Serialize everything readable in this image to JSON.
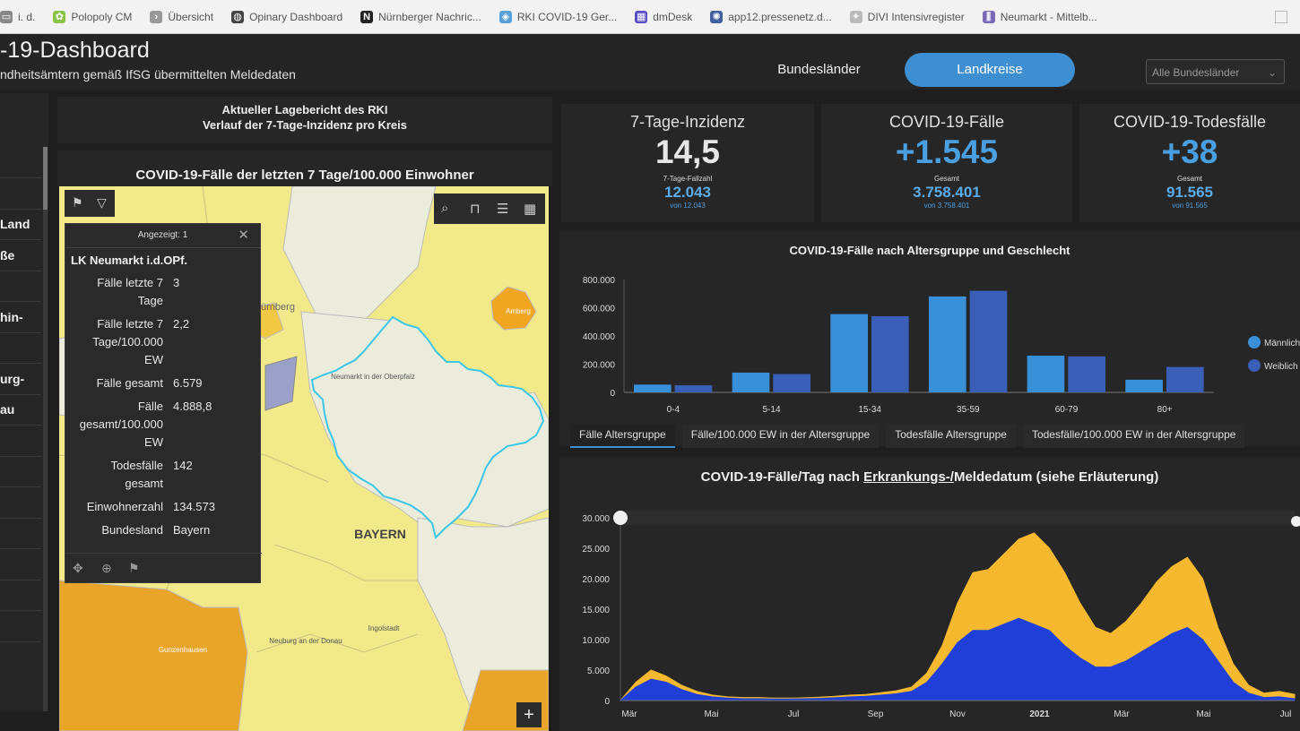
{
  "bookmarks": [
    {
      "label": "i. d.",
      "icon": "tab-icon"
    },
    {
      "label": "Polopoly CM",
      "icon": "leaf-icon"
    },
    {
      "label": "Übersicht",
      "icon": "chevron-icon"
    },
    {
      "label": "Opinary Dashboard",
      "icon": "globe-icon"
    },
    {
      "label": "Nürnberger Nachric...",
      "icon": "nn-icon"
    },
    {
      "label": "RKI COVID-19 Ger...",
      "icon": "shield-icon"
    },
    {
      "label": "dmDesk",
      "icon": "grid-icon"
    },
    {
      "label": "app12.pressenetz.d...",
      "icon": "gear-icon"
    },
    {
      "label": "DIVI Intensivregister",
      "icon": "star-icon"
    },
    {
      "label": "Neumarkt - Mittelb...",
      "icon": "columns-icon"
    }
  ],
  "header": {
    "title": "-19-Dashboard",
    "subtitle": "ndheitsämtern gemäß IfSG übermittelten Meldedaten",
    "tab_bundeslaender": "Bundesländer",
    "tab_landkreise": "Landkreise",
    "select_value": "Alle Bundesländer"
  },
  "sidebar": {
    "items": [
      "",
      "",
      "Land",
      "ße",
      "",
      "hin-",
      "",
      "urg-",
      "au",
      "",
      "",
      "",
      "",
      "",
      "",
      ""
    ]
  },
  "rki": {
    "line1": "Aktueller Lagebericht des RKI",
    "line2": "Verlauf der 7-Tage-Inzidenz pro Kreis"
  },
  "map": {
    "title": "COVID-19-Fälle der letzten 7 Tage/100.000 Einwohner",
    "labels": {
      "bayern": "BAYERN",
      "nurnberg": "ürnberg",
      "amberg": "Amberg",
      "neumarkt": "Neumarkt in der Oberpfalz",
      "neuburg": "Neuburg an der Donau",
      "ingolstadt": "Ingolstadt",
      "gunzenhausen": "Gunzenhausen"
    },
    "colors": {
      "light": "#f2e98a",
      "medium": "#f0c843",
      "dark": "#e8a52a",
      "pale": "#ececdc",
      "outline": "#3cc6e8"
    }
  },
  "popup": {
    "header": "Angezeigt: 1",
    "name": "LK Neumarkt i.d.OPf.",
    "rows": [
      {
        "key_lines": [
          "Fälle letzte 7",
          "Tage"
        ],
        "value": "3"
      },
      {
        "key_lines": [
          "Fälle letzte 7",
          "Tage/100.000",
          "EW"
        ],
        "value": "2,2"
      },
      {
        "key_lines": [
          "Fälle gesamt"
        ],
        "value": "6.579"
      },
      {
        "key_lines": [
          "Fälle",
          "gesamt/100.000",
          "EW"
        ],
        "value": "4.888,8"
      },
      {
        "key_lines": [
          "Todesfälle",
          "gesamt"
        ],
        "value": "142"
      },
      {
        "key_lines": [
          "Einwohnerzahl"
        ],
        "value": "134.573"
      },
      {
        "key_lines": [
          "Bundesland"
        ],
        "value": "Bayern"
      }
    ]
  },
  "kpis": [
    {
      "title": "7-Tage-Inzidenz",
      "value": "14,5",
      "value_color": "#e6e6e6",
      "sub_label": "7-Tage-Fallzahl",
      "sub_value": "12.043",
      "footer": "von 12.043"
    },
    {
      "title": "COVID-19-Fälle",
      "value": "+1.545",
      "value_color": "#4a9fe0",
      "sub_label": "Gesamt",
      "sub_value": "3.758.401",
      "footer": "von 3.758.401"
    },
    {
      "title": "COVID-19-Todesfälle",
      "value": "+38",
      "value_color": "#4a9fe0",
      "sub_label": "Gesamt",
      "sub_value": "91.565",
      "footer": "von 91.565"
    }
  ],
  "age_chart": {
    "title": "COVID-19-Fälle nach Altersgruppe und Geschlecht",
    "tabs": [
      "Fälle Altersgruppe",
      "Fälle/100.000 EW in der Altersgruppe",
      "Todesfälle Altersgruppe",
      "Todesfälle/100.000 EW in der Altersgruppe"
    ],
    "legend": [
      "Männlich",
      "Weiblich"
    ]
  },
  "daily_chart": {
    "title_pre": "COVID-19-Fälle/Tag nach ",
    "title_link": "Erkrankungs-/",
    "title_post": "Meldedatum (siehe Erläuterung)"
  },
  "chart_data": [
    {
      "type": "bar",
      "title": "COVID-19-Fälle nach Altersgruppe und Geschlecht",
      "categories": [
        "0-4",
        "5-14",
        "15-34",
        "35-59",
        "60-79",
        "80+"
      ],
      "series": [
        {
          "name": "Männlich",
          "color": "#3a8fd9",
          "values": [
            55000,
            140000,
            555000,
            680000,
            260000,
            90000
          ]
        },
        {
          "name": "Weiblich",
          "color": "#3a5fb8",
          "values": [
            50000,
            130000,
            540000,
            720000,
            255000,
            180000
          ]
        }
      ],
      "yticks": [
        "0",
        "200.000",
        "400.000",
        "600.000",
        "800.000"
      ],
      "ylim": [
        0,
        800000
      ],
      "legend_position": "right"
    },
    {
      "type": "area",
      "title": "COVID-19-Fälle/Tag nach Erkrankungs-/Meldedatum (siehe Erläuterung)",
      "x_ticks": [
        "Mär",
        "Mai",
        "Jul",
        "Sep",
        "Nov",
        "2021",
        "Mär",
        "Mai",
        "Jul"
      ],
      "yticks": [
        "0",
        "5.000",
        "10.000",
        "15.000",
        "20.000",
        "25.000",
        "30.000"
      ],
      "ylim": [
        0,
        30000
      ],
      "series": [
        {
          "name": "Meldedatum",
          "color": "#f5b82e",
          "values": [
            0,
            3000,
            5000,
            4000,
            2500,
            1500,
            900,
            600,
            500,
            500,
            400,
            400,
            450,
            550,
            700,
            900,
            1000,
            1300,
            1600,
            2200,
            4500,
            9000,
            16000,
            21000,
            21500,
            24000,
            26500,
            27500,
            25000,
            21000,
            16000,
            12000,
            11000,
            13000,
            16000,
            19500,
            22000,
            23500,
            20000,
            12000,
            6000,
            2500,
            1200,
            1500,
            1000
          ]
        },
        {
          "name": "Erkrankungsdatum",
          "color": "#1f3fd8",
          "values": [
            0,
            2200,
            3500,
            3000,
            1800,
            1000,
            600,
            400,
            300,
            300,
            250,
            250,
            300,
            350,
            450,
            600,
            700,
            900,
            1100,
            1500,
            3000,
            6000,
            9500,
            11500,
            11500,
            12500,
            13500,
            12500,
            11500,
            9000,
            7000,
            5500,
            5500,
            6500,
            8000,
            9500,
            11000,
            12000,
            10000,
            6500,
            3000,
            1200,
            500,
            600,
            300
          ]
        }
      ],
      "legend_position": "none"
    }
  ]
}
